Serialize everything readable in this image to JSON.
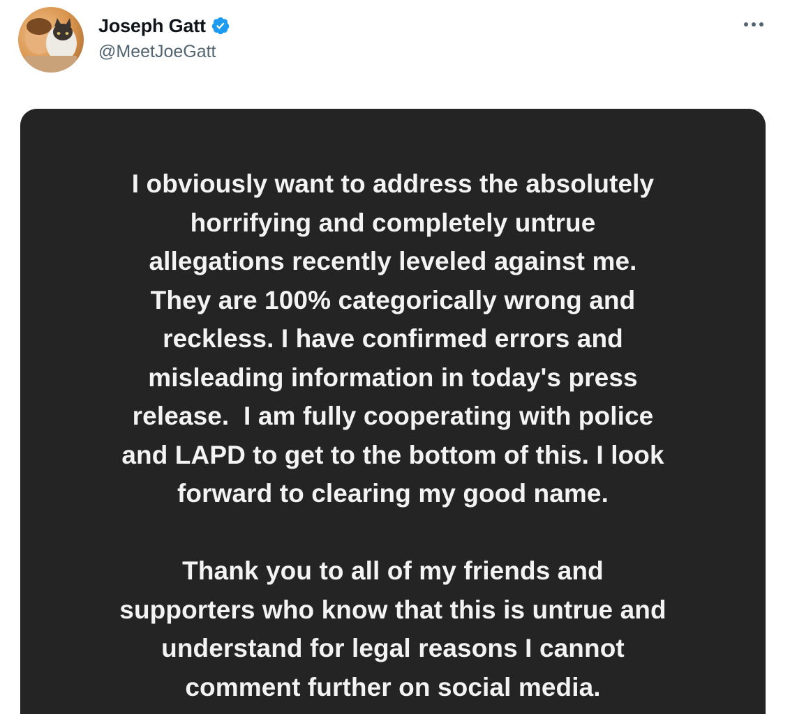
{
  "author": {
    "display_name": "Joseph Gatt",
    "handle": "@MeetJoeGatt",
    "verified": true,
    "avatar_icon": "profile-photo-avatar"
  },
  "actions": {
    "more_icon": "more-horizontal-icon"
  },
  "colors": {
    "verified_badge": "#1d9bf0",
    "media_background": "#242424",
    "statement_text": "#f3f3f3",
    "handle_text": "#536471"
  },
  "statement": {
    "paragraph_1": [
      "I obviously want to address the absolutely",
      "horrifying and completely untrue",
      "allegations recently leveled against me.",
      "They are 100% categorically wrong and",
      "reckless. I have confirmed errors and",
      "misleading information in today's press",
      "release.  I am fully cooperating with police",
      "and LAPD to get to the bottom of this. I look",
      "forward to clearing my good name."
    ],
    "paragraph_2": [
      "Thank you to all of my friends and",
      "supporters who know that this is untrue and",
      "understand for legal reasons I cannot",
      "comment further on social media."
    ]
  }
}
